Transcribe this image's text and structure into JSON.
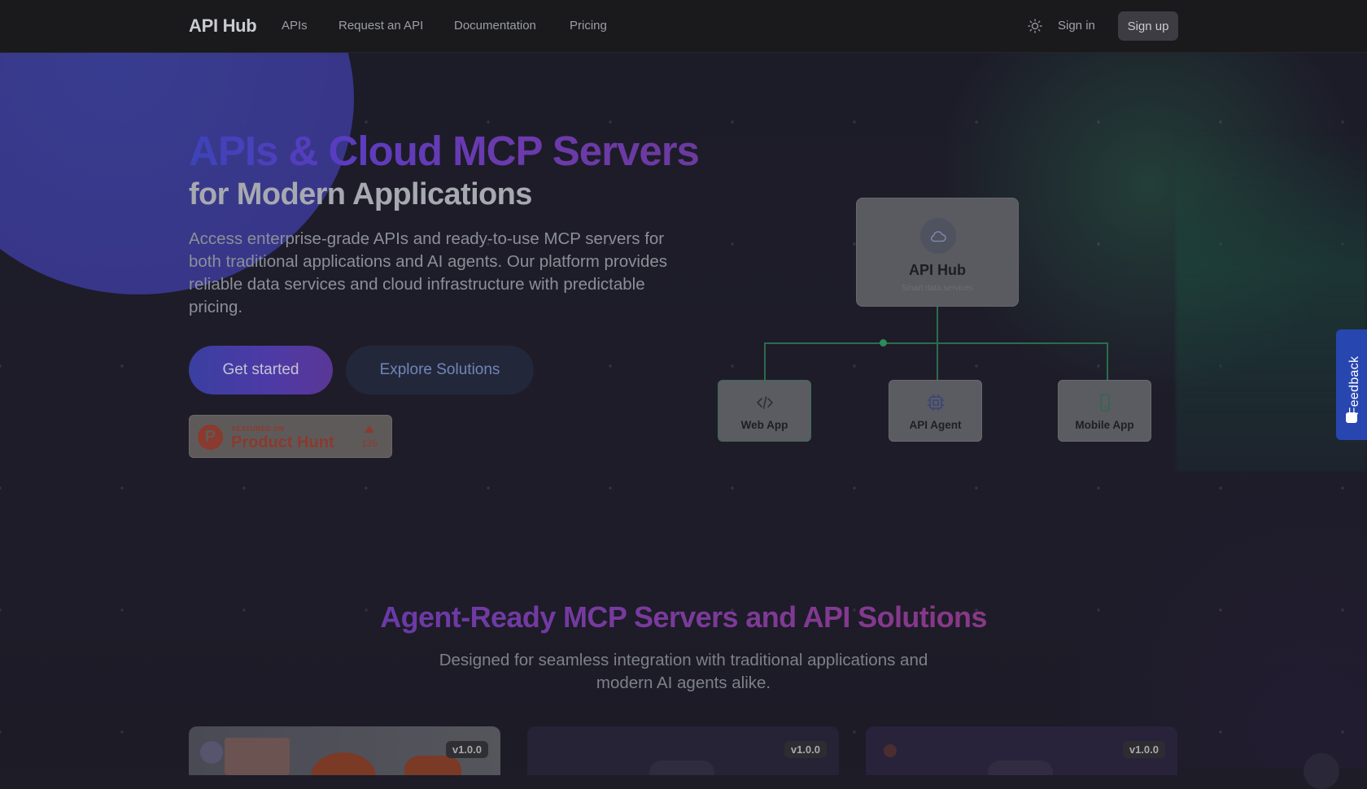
{
  "nav": {
    "brand": "API Hub",
    "links": [
      "APIs",
      "Request an API",
      "Documentation",
      "Pricing"
    ],
    "sign_in": "Sign in",
    "sign_up": "Sign up",
    "theme_icon": "sun-icon"
  },
  "hero": {
    "title": "APIs & Cloud MCP Servers",
    "subtitle": "for Modern Applications",
    "description": "Access enterprise-grade APIs and ready-to-use MCP servers for both traditional applications and AI agents. Our platform provides reliable data services and cloud infrastructure with predictable pricing.",
    "primary_cta": "Get started",
    "secondary_cta": "Explore Solutions",
    "product_hunt": {
      "featured": "FEATURED ON",
      "name": "Product Hunt",
      "votes": "135",
      "logo_letter": "P"
    }
  },
  "diagram": {
    "hub": {
      "title": "API Hub",
      "subtitle": "Smart data services",
      "icon": "cloud-icon"
    },
    "clients": [
      {
        "label": "Web App",
        "icon": "code-icon"
      },
      {
        "label": "API Agent",
        "icon": "cpu-icon"
      },
      {
        "label": "Mobile App",
        "icon": "smartphone-icon"
      }
    ]
  },
  "feedback": {
    "label": "Feedback",
    "icon": "chat-icon"
  },
  "section": {
    "title": "Agent-Ready MCP Servers and API Solutions",
    "description_line1": "Designed for seamless integration with traditional applications and",
    "description_line2": "modern AI agents alike.",
    "cards": [
      {
        "version": "v1.0.0"
      },
      {
        "version": "v1.0.0"
      },
      {
        "version": "v1.0.0"
      }
    ]
  },
  "colors": {
    "accent_blue": "#3a3fa0",
    "accent_purple": "#6b3aae",
    "diagram_green": "#2d8a5b",
    "feedback_blue": "#2846b0",
    "product_hunt": "#8a3a2e"
  }
}
